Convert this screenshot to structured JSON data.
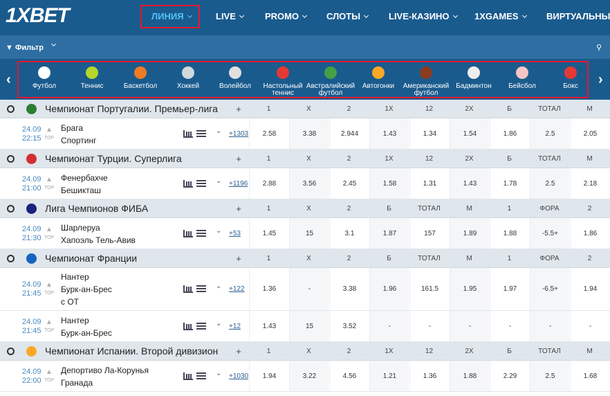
{
  "brand": {
    "logo": "1XBET"
  },
  "nav": [
    {
      "label": "ЛИНИЯ",
      "active": true
    },
    {
      "label": "LIVE"
    },
    {
      "label": "PROMO"
    },
    {
      "label": "СЛОТЫ"
    },
    {
      "label": "LIVE-КАЗИНО"
    },
    {
      "label": "1XGAMES"
    },
    {
      "label": "ВИРТУАЛЬНЫЙ"
    }
  ],
  "filter": {
    "label": "Фильтр"
  },
  "sports": [
    {
      "label": "Футбол",
      "color": "#ffffff"
    },
    {
      "label": "Теннис",
      "color": "#b6d52b"
    },
    {
      "label": "Баскетбол",
      "color": "#f07b26"
    },
    {
      "label": "Хоккей",
      "color": "#cfd8dc"
    },
    {
      "label": "Волейбол",
      "color": "#e0e0e0"
    },
    {
      "label": "Настольный теннис",
      "color": "#e53935"
    },
    {
      "label": "Австралийский футбол",
      "color": "#43a047"
    },
    {
      "label": "Автогонки",
      "color": "#ffa726"
    },
    {
      "label": "Американский футбол",
      "color": "#8d3b1f"
    },
    {
      "label": "Бадминтон",
      "color": "#eeeeee"
    },
    {
      "label": "Бейсбол",
      "color": "#f5c6c6"
    },
    {
      "label": "Бокс",
      "color": "#e53935"
    }
  ],
  "leagues": [
    {
      "name": "Чемпионат Португалии. Премьер-лига",
      "plus": "+",
      "flag": "#2e7d32",
      "cols": [
        "1",
        "X",
        "2",
        "1X",
        "12",
        "2X",
        "Б",
        "ТОТАЛ",
        "М"
      ],
      "events": [
        {
          "date": "24.09",
          "time": "22:15",
          "top": "TOP",
          "teams": [
            "Брага",
            "Спортинг"
          ],
          "more": "+1303",
          "odds": [
            "2.58",
            "3.38",
            "2.944",
            "1.43",
            "1.34",
            "1.54",
            "1.86",
            "2.5",
            "2.05"
          ]
        }
      ]
    },
    {
      "name": "Чемпионат Турции. Суперлига",
      "plus": "+",
      "flag": "#d32f2f",
      "cols": [
        "1",
        "X",
        "2",
        "1X",
        "12",
        "2X",
        "Б",
        "ТОТАЛ",
        "М"
      ],
      "events": [
        {
          "date": "24.09",
          "time": "21:00",
          "top": "TOP",
          "teams": [
            "Фенербахче",
            "Бешикташ"
          ],
          "more": "+1196",
          "odds": [
            "2.88",
            "3.56",
            "2.45",
            "1.58",
            "1.31",
            "1.43",
            "1.78",
            "2.5",
            "2.18"
          ]
        }
      ]
    },
    {
      "name": "Лига Чемпионов ФИБА",
      "plus": "+",
      "flag": "#1a237e",
      "cols": [
        "1",
        "X",
        "2",
        "Б",
        "ТОТАЛ",
        "М",
        "1",
        "ФОРА",
        "2"
      ],
      "events": [
        {
          "date": "24.09",
          "time": "21:30",
          "top": "TOP",
          "teams": [
            "Шарлеруа",
            "Хапоэль Тель-Авив"
          ],
          "more": "+53",
          "odds": [
            "1.45",
            "15",
            "3.1",
            "1.87",
            "157",
            "1.89",
            "1.88",
            "-5.5+",
            "1.86"
          ]
        }
      ]
    },
    {
      "name": "Чемпионат Франции",
      "plus": "+",
      "flag": "#1565c0",
      "cols": [
        "1",
        "X",
        "2",
        "Б",
        "ТОТАЛ",
        "М",
        "1",
        "ФОРА",
        "2"
      ],
      "events": [
        {
          "date": "24.09",
          "time": "21:45",
          "top": "TOP",
          "teams": [
            "Нантер",
            "Бурк-ан-Брес",
            "с ОТ"
          ],
          "more": "+122",
          "odds": [
            "1.36",
            "-",
            "3.38",
            "1.96",
            "161.5",
            "1.95",
            "1.97",
            "-6.5+",
            "1.94"
          ]
        },
        {
          "date": "24.09",
          "time": "21:45",
          "top": "TOP",
          "teams": [
            "Нантер",
            "Бурк-ан-Брес"
          ],
          "more": "+12",
          "odds": [
            "1.43",
            "15",
            "3.52",
            "-",
            "-",
            "-",
            "-",
            "-",
            "-"
          ]
        }
      ]
    },
    {
      "name": "Чемпионат Испании. Второй дивизион",
      "plus": "+",
      "flag": "#f9a825",
      "cols": [
        "1",
        "X",
        "2",
        "1X",
        "12",
        "2X",
        "Б",
        "ТОТАЛ",
        "М"
      ],
      "events": [
        {
          "date": "24.09",
          "time": "22:00",
          "top": "TOP",
          "teams": [
            "Депортиво Ла-Корунья",
            "Гранада"
          ],
          "more": "+1030",
          "odds": [
            "1.94",
            "3.22",
            "4.56",
            "1.21",
            "1.36",
            "1.88",
            "2.29",
            "2.5",
            "1.68"
          ]
        }
      ]
    }
  ]
}
